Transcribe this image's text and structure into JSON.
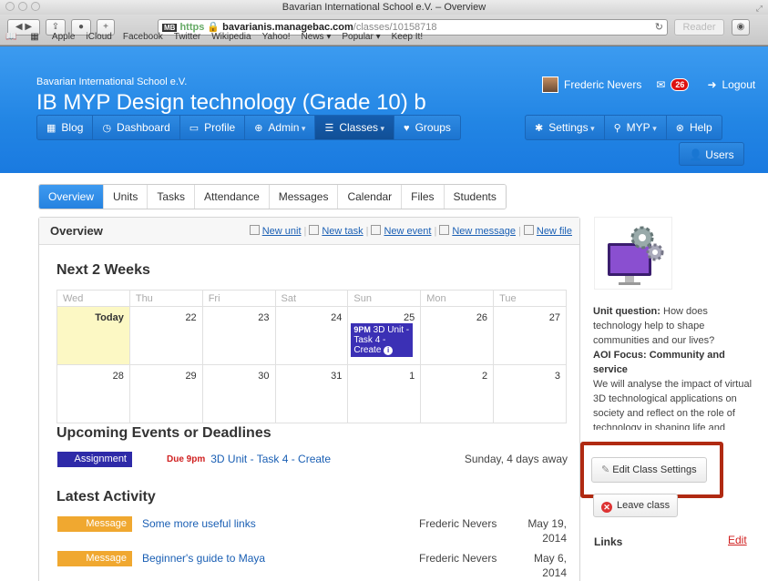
{
  "window": {
    "title": "Bavarian International School e.V. – Overview"
  },
  "browser": {
    "url_badge": "MB",
    "url_scheme": "https",
    "url_host": "bavarianis.managebac.com",
    "url_path": "/classes/10158718",
    "reader_label": "Reader",
    "bookmarks": [
      "Apple",
      "iCloud",
      "Facebook",
      "Twitter",
      "Wikipedia",
      "Yahoo!",
      "News ▾",
      "Popular ▾",
      "Keep It!"
    ]
  },
  "header": {
    "school": "Bavarian International School e.V.",
    "class_title": "IB MYP Design technology (Grade 10) b",
    "user_name": "Frederic Nevers",
    "messages_count": "26",
    "logout": "Logout"
  },
  "nav_left": [
    {
      "label": "Blog",
      "icon": "▦"
    },
    {
      "label": "Dashboard",
      "icon": "◷"
    },
    {
      "label": "Profile",
      "icon": "▭"
    },
    {
      "label": "Admin",
      "icon": "⊕",
      "dropdown": true
    },
    {
      "label": "Classes",
      "icon": "☰",
      "dropdown": true
    },
    {
      "label": "Groups",
      "icon": "♥"
    }
  ],
  "nav_right": [
    {
      "label": "Settings",
      "icon": "✱",
      "dropdown": true
    },
    {
      "label": "MYP",
      "icon": "⚲",
      "dropdown": true
    },
    {
      "label": "Help",
      "icon": "⊗"
    }
  ],
  "users_label": "Users",
  "tabs": [
    "Overview",
    "Units",
    "Tasks",
    "Attendance",
    "Messages",
    "Calendar",
    "Files",
    "Students"
  ],
  "panel": {
    "title": "Overview",
    "actions": [
      "New unit",
      "New task",
      "New event",
      "New message",
      "New file"
    ]
  },
  "calendar": {
    "heading": "Next 2 Weeks",
    "days": [
      "Wed",
      "Thu",
      "Fri",
      "Sat",
      "Sun",
      "Mon",
      "Tue"
    ],
    "week1": [
      "Today",
      "22",
      "23",
      "24",
      "25",
      "26",
      "27"
    ],
    "week2": [
      "28",
      "29",
      "30",
      "31",
      "1",
      "2",
      "3"
    ],
    "event": {
      "time": "9PM",
      "title": "3D Unit - Task 4 - Create"
    }
  },
  "upcoming": {
    "heading": "Upcoming Events or Deadlines",
    "items": [
      {
        "type": "Assignment",
        "due": "Due 9pm",
        "title": "3D Unit - Task 4 - Create",
        "when": "Sunday, 4 days away"
      }
    ]
  },
  "activity": {
    "heading": "Latest Activity",
    "items": [
      {
        "type": "Message",
        "title": "Some more useful links",
        "author": "Frederic Nevers",
        "date1": "May 19,",
        "date2": "2014"
      },
      {
        "type": "Message",
        "title": "Beginner's guide to Maya",
        "author": "Frederic Nevers",
        "date1": "May 6,",
        "date2": "2014"
      }
    ]
  },
  "sidebar": {
    "unit_q_label": "Unit question:",
    "unit_q": " How does technology help to shape communities and our lives?",
    "aoi_label": "AOI Focus: Community and service",
    "desc": "We will analyse the impact of virtual 3D technological applications on society and reflect on the role of technology in shaping life and society",
    "edit_settings": "Edit Class Settings",
    "leave_class": "Leave class",
    "links_label": "Links",
    "links_edit": "Edit"
  },
  "colors": {
    "header": "#2285e4",
    "assignment": "#2e2aa8",
    "message": "#f0a830",
    "highlight": "#b02a12"
  }
}
